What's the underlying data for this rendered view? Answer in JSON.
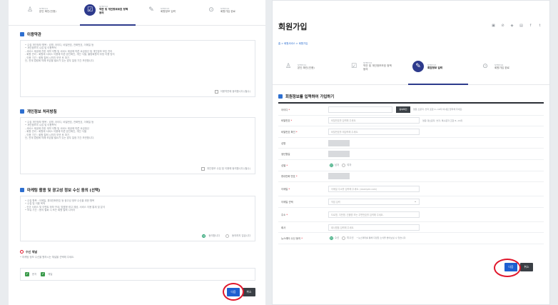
{
  "left": {
    "steps": [
      {
        "num": "STEP 01",
        "label": "본인 확인(인증)",
        "icon": "user-icon"
      },
      {
        "num": "STEP 02",
        "label": "약관 및 개인정보보호 정책 동의",
        "icon": "agree-icon",
        "active": true
      },
      {
        "num": "STEP 03",
        "label": "회원정보 입력",
        "icon": "edit-icon"
      },
      {
        "num": "STEP 04",
        "label": "회원가입 완료",
        "icon": "check-icon"
      }
    ],
    "terms_title": "이용약관",
    "terms_lines": [
      "• 수집 개인정보 항목 : 성명, 아이디, 비밀번호, 전화번호, 이메일 등",
      "• 개인정보의 수집 및 이용목적",
      "   - 서비스 제공에 관한 계약 이행 및 서비스 제공에 따른 요금정산 및 개인정보 보호 관리",
      "   - 회원 관리 : 회원제 서비스 이용에 따른 본인확인, 개인 식별, 불량회원의 부정 이용 방지",
      "   - 이용 기간 : 회원 탈퇴 시까지 보관 후 파기",
      "   단, 관계 법령에 의해 보존할 필요가 있는 경우 일정 기간 보관합니다."
    ],
    "terms_agree": "이용약관에 동의합니다.(필수)",
    "privacy_title": "개인정보 처리방침",
    "privacy_lines": [
      "• 수집 개인정보 항목 : 성명, 아이디, 비밀번호, 전화번호, 이메일 등",
      "• 개인정보의 수집 및 이용목적",
      "   - 서비스 제공에 관한 계약 이행 및 서비스 제공에 따른 요금정산",
      "   - 회원 관리 : 회원제 서비스 이용에 따른 본인확인, 개인 식별",
      "   - 이용 기간 : 회원 탈퇴 시까지 보관 후 파기",
      "   단, 관계 법령에 의해 보존할 필요가 있는 경우 일정 기간 보관합니다."
    ],
    "privacy_agree": "개인정보 수집 및 이용에 동의합니다.(필수)",
    "marketing_title": "마케팅 활용 및 광고성 정보 수신 동의 (선택)",
    "marketing_lines": [
      "• 수집 항목 : 이메일, 휴대전화번호 등 광고성 정보 수신을 위한 항목",
      "• 수집 및 이용 목적",
      "   - 신규 서비스 및 이벤트 정보 안내, 맞춤형 광고 제공, 서비스 이용 통계 및 분석",
      "• 보유 기간 : 동의 철회 시 또는 회원 탈퇴 시까지"
    ],
    "marketing_yes": "동의합니다",
    "marketing_no": "동의하지 않습니다",
    "receive_title": "수신 채널",
    "receive_desc": "• 마케팅 정보 수신을 원하시는 채널을 선택해 주세요.",
    "receive_sms": "문자",
    "receive_email": "메일",
    "next": "다음",
    "cancel": "취소"
  },
  "right": {
    "page_title": "회원가입",
    "breadcrumb": "홈 > 회원서비스 > 회원가입",
    "share_icons": [
      "print-icon",
      "link-icon",
      "share-icon",
      "blog-icon",
      "facebook-icon",
      "twitter-icon"
    ],
    "steps": [
      {
        "num": "STEP 01",
        "label": "본인 확인(인증)",
        "icon": "user-icon"
      },
      {
        "num": "STEP 02",
        "label": "약관 및 개인정보보호 정책 동의",
        "icon": "agree-icon"
      },
      {
        "num": "STEP 03",
        "label": "회원정보 입력",
        "icon": "edit-icon",
        "active": true
      },
      {
        "num": "STEP 04",
        "label": "회원가입 완료",
        "icon": "check-icon"
      }
    ],
    "form_title": "회원정보를 입력하여 가입하기",
    "fields": [
      {
        "label": "아이디",
        "required": true,
        "placeholder": "",
        "button": "중복확인",
        "note": "영문 소문자, 숫자 포함 4~16자 이내로 입력해 주세요."
      },
      {
        "label": "비밀번호",
        "required": true,
        "placeholder": "비밀번호를 입력해 주세요.",
        "note": "영문 대소문자, 숫자, 특수문자 조합 8~16자"
      },
      {
        "label": "비밀번호 확인",
        "required": true,
        "placeholder": "비밀번호를 재입력해 주세요."
      },
      {
        "label": "성명",
        "type": "gray"
      },
      {
        "label": "생년월일",
        "type": "gray"
      },
      {
        "label": "성별",
        "required": true,
        "type": "radio",
        "options": [
          "남자",
          "여자"
        ]
      },
      {
        "label": "휴대전화 번호",
        "required": true,
        "type": "gray"
      },
      {
        "label": "이메일",
        "required": true,
        "placeholder": "이메일 주소를 입력해 주세요. (example.com)"
      },
      {
        "label": "이메일 선택",
        "type": "select",
        "placeholder": "직접 입력"
      },
      {
        "label": "주소",
        "required": true,
        "placeholder": "도로명, 지번명, 건물명 또는 우편번호를 입력해 주세요."
      },
      {
        "label": "회사",
        "placeholder": "회사명을 입력해 주세요."
      },
      {
        "label": "뉴스레터 수신 동의",
        "required": true,
        "type": "radio",
        "options": [
          "수신",
          "미수신"
        ],
        "note": "* 뉴스레터를 통해 다양한 소식을 받아보실 수 있습니다."
      }
    ],
    "next": "다음",
    "cancel": "취소"
  }
}
